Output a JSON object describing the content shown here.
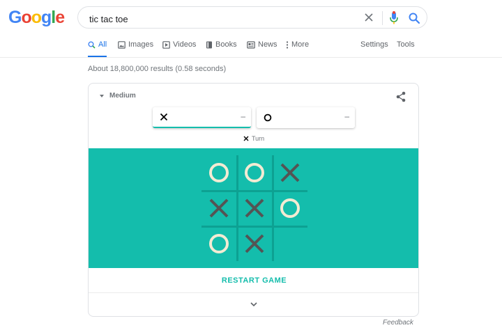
{
  "logo": {
    "letters": [
      "G",
      "o",
      "o",
      "g",
      "l",
      "e"
    ],
    "colors": [
      "#4285f4",
      "#ea4335",
      "#fbbc05",
      "#4285f4",
      "#34a853",
      "#ea4335"
    ]
  },
  "search": {
    "query": "tic tac toe"
  },
  "tabs": [
    {
      "label": "All",
      "icon": "search-icon",
      "active": true
    },
    {
      "label": "Images",
      "icon": "image-icon"
    },
    {
      "label": "Videos",
      "icon": "play-icon"
    },
    {
      "label": "Books",
      "icon": "book-icon"
    },
    {
      "label": "News",
      "icon": "news-icon"
    },
    {
      "label": "More",
      "icon": "more-vert-icon"
    }
  ],
  "tools": {
    "settings": "Settings",
    "tools": "Tools"
  },
  "results_stats": "About 18,800,000 results (0.58 seconds)",
  "game": {
    "difficulty": "Medium",
    "player_x": {
      "symbol": "X",
      "score": "–"
    },
    "player_o": {
      "symbol": "O",
      "score": "–"
    },
    "turn_label": "Turn",
    "board": [
      "O",
      "O",
      "X",
      "X",
      "X",
      "O",
      "O",
      "X",
      ""
    ],
    "restart_label": "RESTART GAME",
    "colors": {
      "board_bg": "#14bdac",
      "o_mark": "#f2ebd3",
      "x_mark": "#545454",
      "grid": "#0da192"
    }
  },
  "feedback": "Feedback"
}
